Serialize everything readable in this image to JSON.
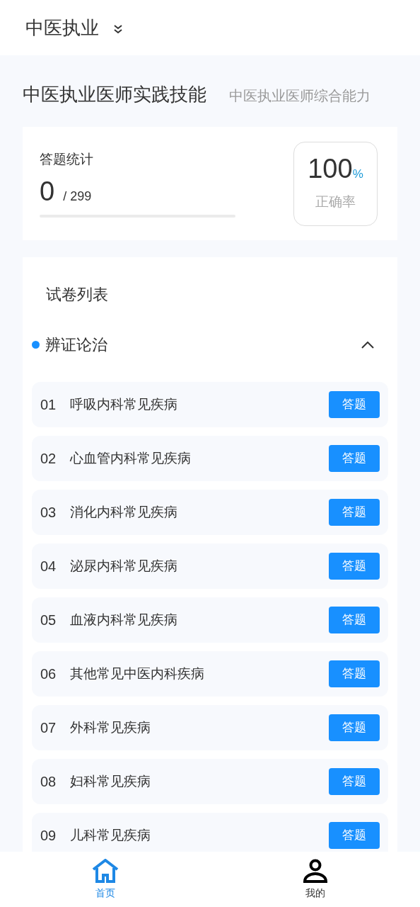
{
  "header": {
    "title": "中医执业"
  },
  "subjects": [
    {
      "label": "中医执业医师实践技能",
      "selected": true
    },
    {
      "label": "中医执业医师综合能力",
      "selected": false
    }
  ],
  "stats": {
    "title": "答题统计",
    "answered": "0",
    "total": "/ 299",
    "level": 0,
    "accuracy": "100",
    "accuracy_unit": "%",
    "accuracy_label": "正确率"
  },
  "paper_list": {
    "title": "试卷列表",
    "sections": [
      {
        "title": "辨证论治",
        "expanded": true,
        "items": [
          {
            "number": "01",
            "name": "呼吸内科常见疾病",
            "action": "答题"
          },
          {
            "number": "02",
            "name": "心血管内科常见疾病",
            "action": "答题"
          },
          {
            "number": "03",
            "name": "消化内科常见疾病",
            "action": "答题"
          },
          {
            "number": "04",
            "name": "泌尿内科常见疾病",
            "action": "答题"
          },
          {
            "number": "05",
            "name": "血液内科常见疾病",
            "action": "答题"
          },
          {
            "number": "06",
            "name": "其他常见中医内科疾病",
            "action": "答题"
          },
          {
            "number": "07",
            "name": "外科常见疾病",
            "action": "答题"
          },
          {
            "number": "08",
            "name": "妇科常见疾病",
            "action": "答题"
          },
          {
            "number": "09",
            "name": "儿科常见疾病",
            "action": "答题"
          }
        ]
      }
    ]
  },
  "tab_bar": [
    {
      "kind": "home",
      "label": "首页",
      "selected": true
    },
    {
      "kind": "profile",
      "label": "我的",
      "selected": false
    }
  ]
}
